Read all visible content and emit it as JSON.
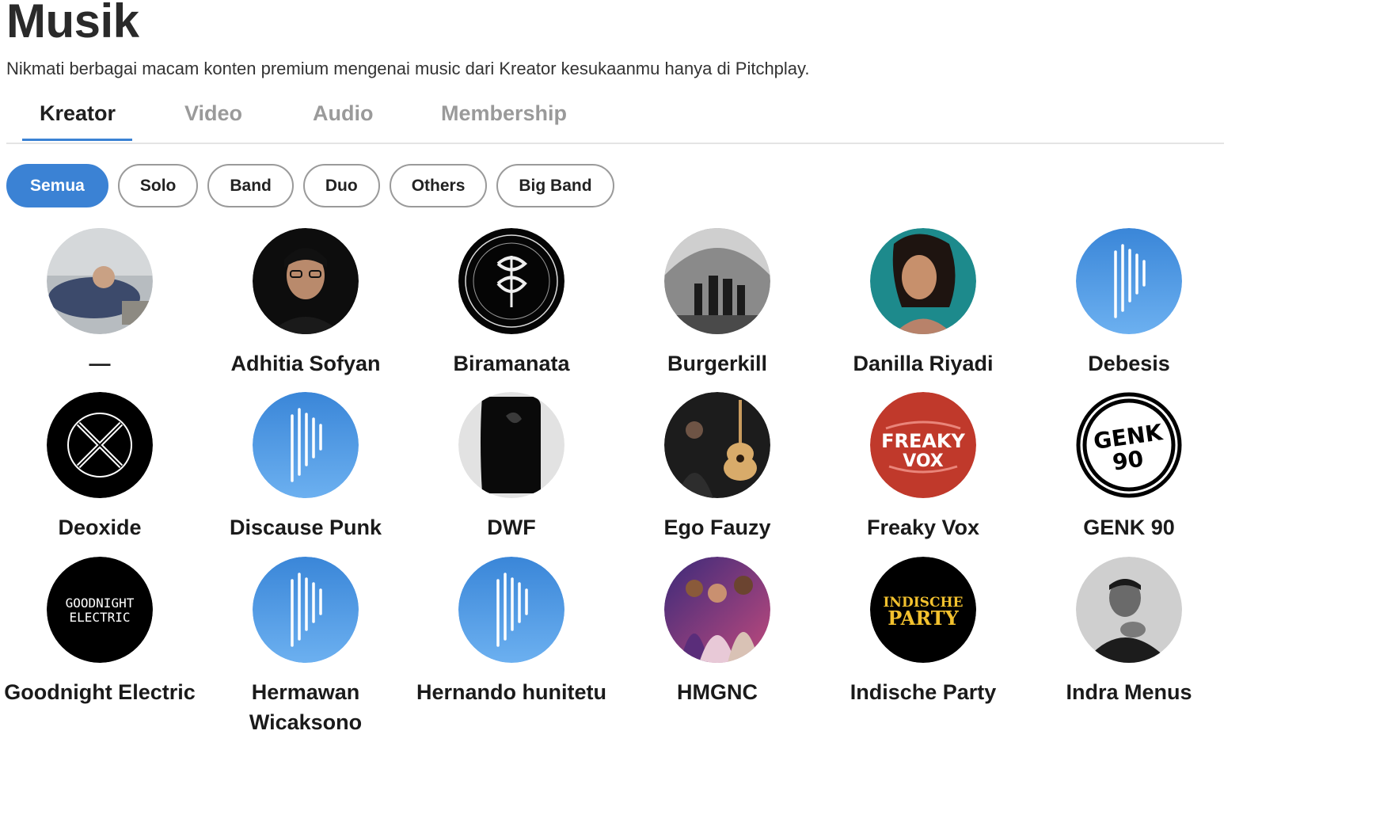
{
  "page": {
    "title": "Musik",
    "subtitle": "Nikmati berbagai macam konten premium mengenai music dari Kreator kesukaanmu hanya di Pitchplay."
  },
  "tabs": [
    {
      "label": "Kreator",
      "active": true
    },
    {
      "label": "Video",
      "active": false
    },
    {
      "label": "Audio",
      "active": false
    },
    {
      "label": "Membership",
      "active": false
    }
  ],
  "filters": [
    {
      "label": "Semua",
      "active": true
    },
    {
      "label": "Solo",
      "active": false
    },
    {
      "label": "Band",
      "active": false
    },
    {
      "label": "Duo",
      "active": false
    },
    {
      "label": "Others",
      "active": false
    },
    {
      "label": "Big Band",
      "active": false
    }
  ],
  "creators": [
    {
      "name": "—",
      "avatar": "photo-gray"
    },
    {
      "name": "Adhitia Sofyan",
      "avatar": "photo-dark"
    },
    {
      "name": "Biramanata",
      "avatar": "biramanata-logo"
    },
    {
      "name": "Burgerkill",
      "avatar": "photo-bw"
    },
    {
      "name": "Danilla Riyadi",
      "avatar": "photo-teal"
    },
    {
      "name": "Debesis",
      "avatar": "pitchplay-default"
    },
    {
      "name": "Deoxide",
      "avatar": "x-logo"
    },
    {
      "name": "Discause Punk",
      "avatar": "pitchplay-default"
    },
    {
      "name": "DWF",
      "avatar": "photo-dwf"
    },
    {
      "name": "Ego Fauzy",
      "avatar": "photo-guitar"
    },
    {
      "name": "Freaky Vox",
      "avatar": "freaky-vox-logo"
    },
    {
      "name": "GENK 90",
      "avatar": "genk-90-logo"
    },
    {
      "name": "Goodnight Electric",
      "avatar": "goodnight-electric-logo"
    },
    {
      "name": "Hermawan Wicaksono",
      "avatar": "pitchplay-default"
    },
    {
      "name": "Hernando hunitetu",
      "avatar": "pitchplay-default"
    },
    {
      "name": "HMGNC",
      "avatar": "photo-hmgnc"
    },
    {
      "name": "Indische Party",
      "avatar": "indische-party-logo"
    },
    {
      "name": "Indra Menus",
      "avatar": "photo-bw-portrait"
    }
  ],
  "logo_text": {
    "freaky_vox": [
      "FREAKY",
      "VOX"
    ],
    "genk_90": [
      "GENK",
      "90"
    ],
    "goodnight_electric": [
      "GOODNIGHT",
      "ELECTRIC"
    ],
    "indische_party": [
      "INDISCHE",
      "PARTY"
    ]
  },
  "colors": {
    "accent": "#3b82d4",
    "pitchplay_top": "#3a86d8",
    "pitchplay_bottom": "#6cb0f0",
    "freaky_vox_red": "#c0392b",
    "indische_yellow": "#f2c12e"
  }
}
